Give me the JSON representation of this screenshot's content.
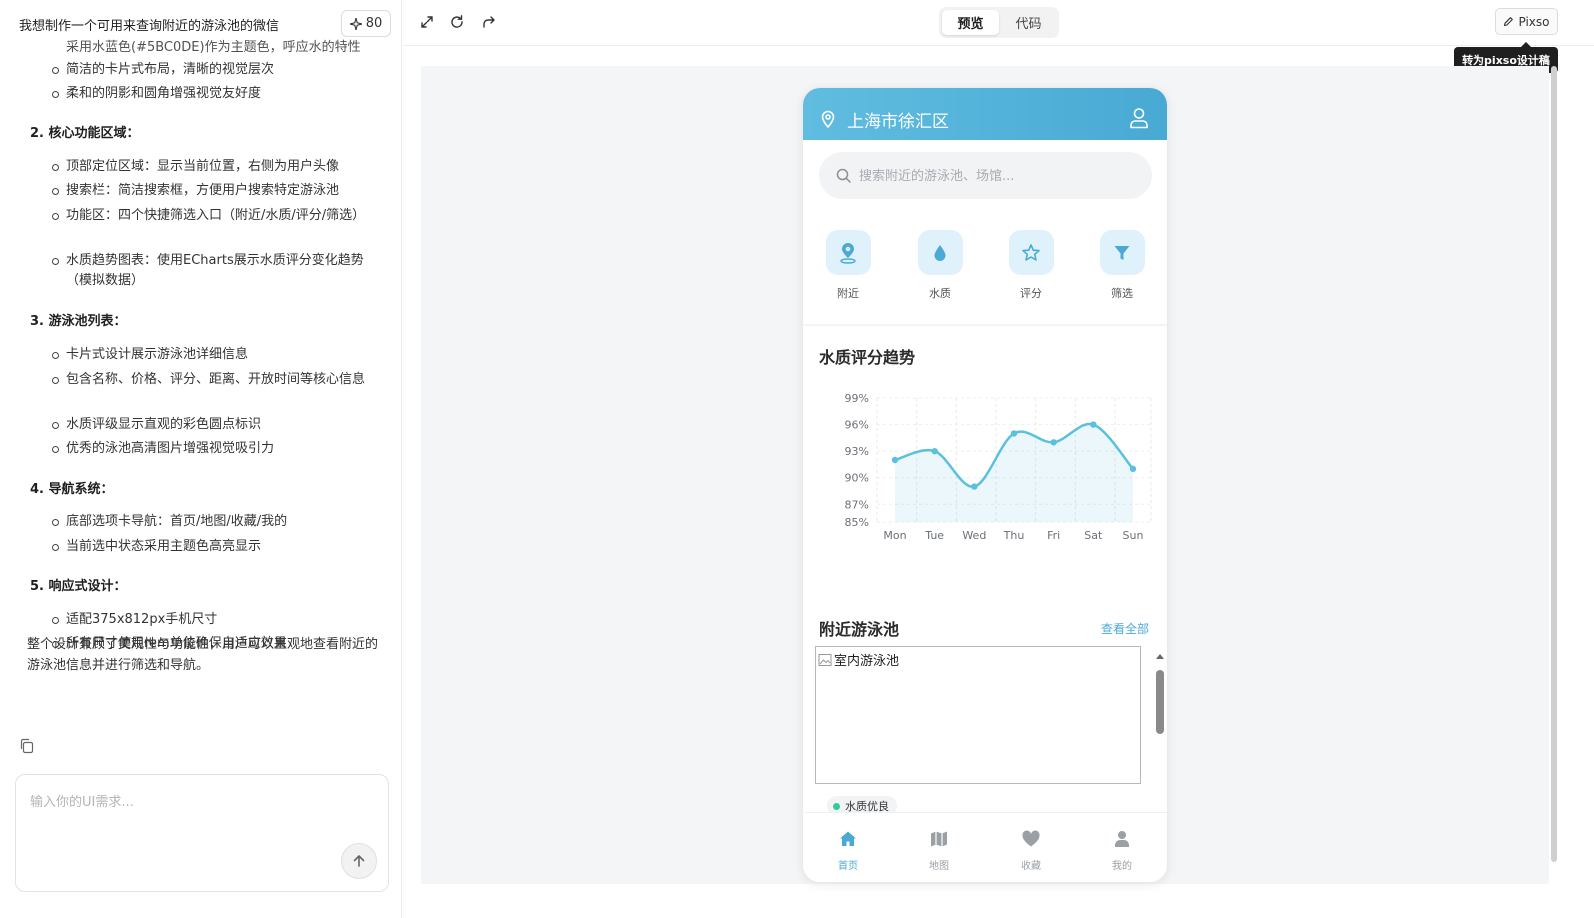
{
  "chat": {
    "title": "我想制作一个可用来查询附近的游泳池的微信",
    "credits": "80",
    "cut_line": "采用水蓝色(#5BC0DE)作为主题色，呼应水的特性",
    "style_bullets": [
      "简洁的卡片式布局，清晰的视觉层次",
      "柔和的阴影和圆角增强视觉友好度"
    ],
    "sections": [
      {
        "title": "2. 核心功能区域：",
        "bullets": [
          "顶部定位区域：显示当前位置，右侧为用户头像",
          "搜索栏：简洁搜索框，方便用户搜索特定游泳池",
          "功能区：四个快捷筛选入口（附近/水质/评分/筛选）",
          "水质趋势图表：使用ECharts展示水质评分变化趋势（模拟数据）"
        ]
      },
      {
        "title": "3. 游泳池列表：",
        "bullets": [
          "卡片式设计展示游泳池详细信息",
          "包含名称、价格、评分、距离、开放时间等核心信息",
          "水质评级显示直观的彩色圆点标识",
          "优秀的泳池高清图片增强视觉吸引力"
        ]
      },
      {
        "title": "4. 导航系统：",
        "bullets": [
          "底部选项卡导航：首页/地图/收藏/我的",
          "当前选中状态采用主题色高亮显示"
        ]
      },
      {
        "title": "5. 响应式设计：",
        "bullets": [
          "适配375x812px手机尺寸",
          "所有尺寸使用rem单位确保自适应效果"
        ]
      }
    ],
    "summary": "整个设计兼顾了美观性与功能性，用户可以直观地查看附近的游泳池信息并进行筛选和导航。",
    "input_placeholder": "输入你的UI需求..."
  },
  "toolbar": {
    "tab_preview": "预览",
    "tab_code": "代码",
    "pixso_label": "Pixso",
    "tooltip": "转为pixso设计稿"
  },
  "phone": {
    "location": "上海市徐汇区",
    "search_placeholder": "搜索附近的游泳池、场馆...",
    "quick": [
      {
        "label": "附近",
        "icon": "location-pin-icon"
      },
      {
        "label": "水质",
        "icon": "water-drop-icon"
      },
      {
        "label": "评分",
        "icon": "star-icon"
      },
      {
        "label": "筛选",
        "icon": "filter-icon"
      }
    ],
    "chart_title": "水质评分趋势",
    "pools_title": "附近游泳池",
    "see_all": "查看全部",
    "pool_image_alt": "室内游泳池",
    "quality_badge": "水质优良",
    "tabs": [
      {
        "label": "首页",
        "icon": "home-icon",
        "active": true
      },
      {
        "label": "地图",
        "icon": "map-icon",
        "active": false
      },
      {
        "label": "收藏",
        "icon": "heart-icon",
        "active": false
      },
      {
        "label": "我的",
        "icon": "person-icon",
        "active": false
      }
    ],
    "theme_color": "#5BC0DE"
  },
  "chart_data": {
    "type": "line",
    "categories": [
      "Mon",
      "Tue",
      "Wed",
      "Thu",
      "Fri",
      "Sat",
      "Sun"
    ],
    "series": [
      {
        "values": [
          92,
          93,
          89,
          95,
          94,
          96,
          91
        ]
      }
    ],
    "yticks": [
      "99%",
      "96%",
      "93%",
      "90%",
      "87%",
      "85%"
    ],
    "ylim": [
      85,
      99
    ],
    "smooth": true,
    "area_fill": true,
    "color": "#5BC0DE"
  }
}
